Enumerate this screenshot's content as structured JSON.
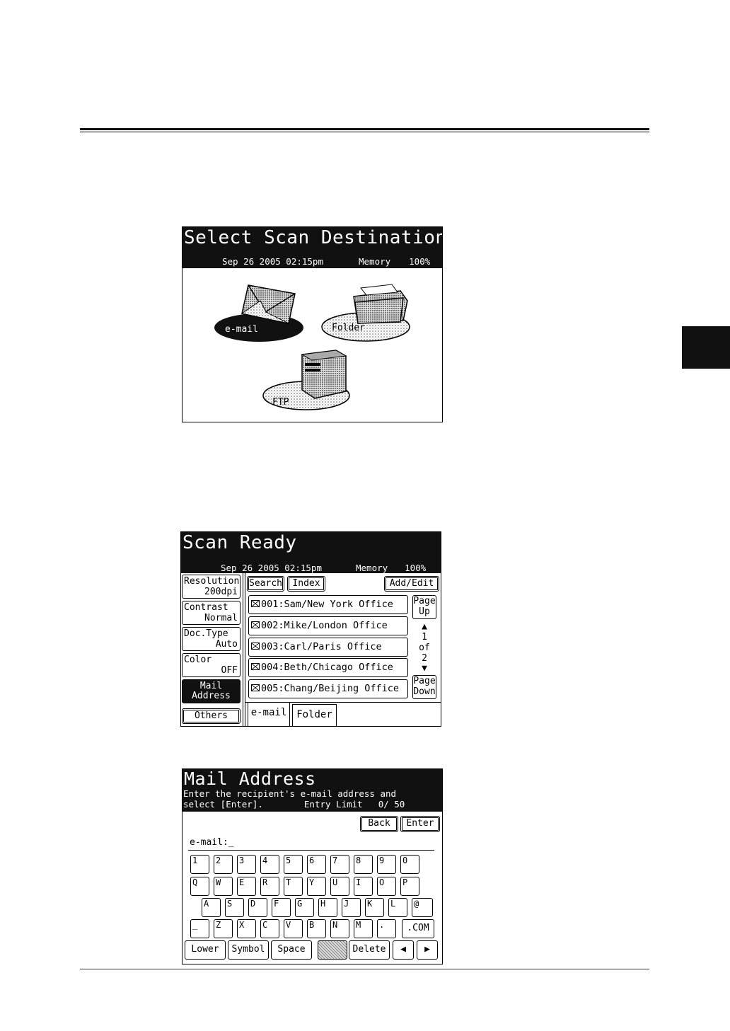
{
  "screen1": {
    "title": "Select Scan Destination",
    "date": "Sep 26 2005 02:15pm",
    "memory_label": "Memory",
    "memory_pct": "100%",
    "destinations": [
      {
        "label": "e-mail",
        "icon": "envelope-icon",
        "selected": true
      },
      {
        "label": "Folder",
        "icon": "folder-icon",
        "selected": false
      },
      {
        "label": "FTP",
        "icon": "server-icon",
        "selected": false
      }
    ]
  },
  "screen2": {
    "title": "Scan Ready",
    "date": "Sep 26 2005 02:15pm",
    "memory_label": "Memory",
    "memory_pct": "100%",
    "side_buttons": [
      {
        "label": "Resolution",
        "value": "200dpi"
      },
      {
        "label": "Contrast",
        "value": "Normal"
      },
      {
        "label": "Doc.Type",
        "value": "Auto"
      },
      {
        "label": "Color",
        "value": "OFF"
      }
    ],
    "mail_address": {
      "line1": "Mail",
      "line2": "Address"
    },
    "others_label": "Others",
    "search_label": "Search",
    "index_label": "Index",
    "add_edit_label": "Add/Edit",
    "entries": [
      "001:Sam/New York Office",
      "002:Mike/London Office",
      "003:Carl/Paris Office",
      "004:Beth/Chicago Office",
      "005:Chang/Beijing Office"
    ],
    "page_up": {
      "line1": "Page",
      "line2": "Up"
    },
    "page_down": {
      "line1": "Page",
      "line2": "Down"
    },
    "page_current": "1",
    "page_of": "of",
    "page_total": "2",
    "up_arrow": "▲",
    "down_arrow": "▼",
    "tabs": [
      "e-mail",
      "Folder"
    ]
  },
  "screen3": {
    "title": "Mail Address",
    "message_line1": "Enter the recipient's e-mail address and",
    "message_line2": "select [Enter].",
    "entry_limit_label": "Entry Limit",
    "entry_limit_value": "0/ 50",
    "back_label": "Back",
    "enter_label": "Enter",
    "field_label": "e-mail:_",
    "keyboard": {
      "row1": [
        "1",
        "2",
        "3",
        "4",
        "5",
        "6",
        "7",
        "8",
        "9",
        "0"
      ],
      "row2": [
        "Q",
        "W",
        "E",
        "R",
        "T",
        "Y",
        "U",
        "I",
        "O",
        "P"
      ],
      "row3": [
        "A",
        "S",
        "D",
        "F",
        "G",
        "H",
        "J",
        "K",
        "L",
        "@"
      ],
      "row4": [
        "_",
        "Z",
        "X",
        "C",
        "V",
        "B",
        "N",
        "M",
        "."
      ],
      "com_key": ".COM",
      "lower": "Lower",
      "symbol": "Symbol",
      "space": "Space",
      "delete": "Delete",
      "left": "◀",
      "right": "▶"
    }
  }
}
